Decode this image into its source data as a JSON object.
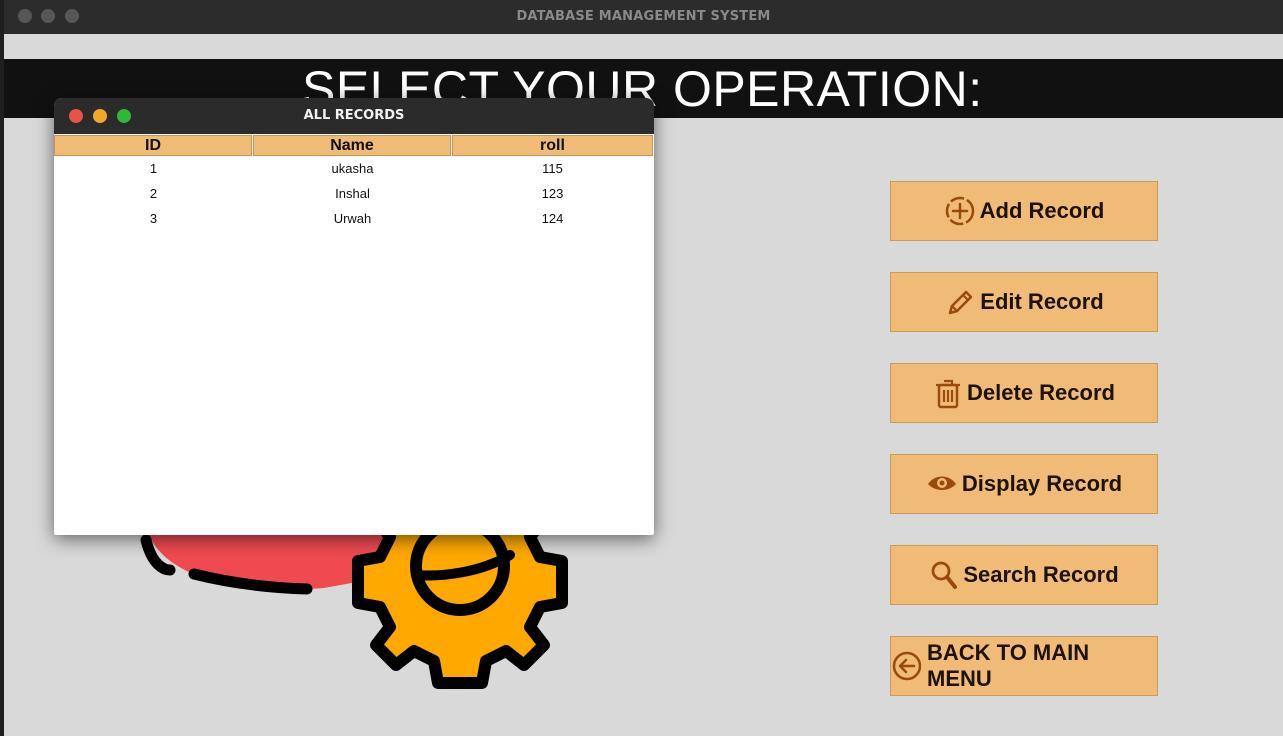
{
  "window": {
    "title": "DATABASE MANAGEMENT SYSTEM"
  },
  "heading": "SELECT YOUR OPERATION:",
  "buttons": {
    "add": {
      "label": "Add Record",
      "icon": "add-circle-icon"
    },
    "edit": {
      "label": "Edit Record",
      "icon": "pencil-icon"
    },
    "delete": {
      "label": "Delete Record",
      "icon": "trash-icon"
    },
    "display": {
      "label": "Display Record",
      "icon": "eye-icon"
    },
    "search": {
      "label": "Search Record",
      "icon": "magnifier-icon"
    },
    "back": {
      "label": "BACK TO MAIN MENU",
      "icon": "arrow-left-circle-icon"
    }
  },
  "records_window": {
    "title": "ALL RECORDS",
    "columns": [
      "ID",
      "Name",
      "roll"
    ],
    "rows": [
      [
        "1",
        "ukasha",
        "115"
      ],
      [
        "2",
        "Inshal",
        "123"
      ],
      [
        "3",
        "Urwah",
        "124"
      ]
    ]
  },
  "colors": {
    "button_bg": "#efbb77",
    "icon_color": "#9a4a0a",
    "heading_band": "#111111",
    "background": "#d9d9d9",
    "gear_orange": "#ffa800",
    "gear_red": "#ef4a50"
  }
}
